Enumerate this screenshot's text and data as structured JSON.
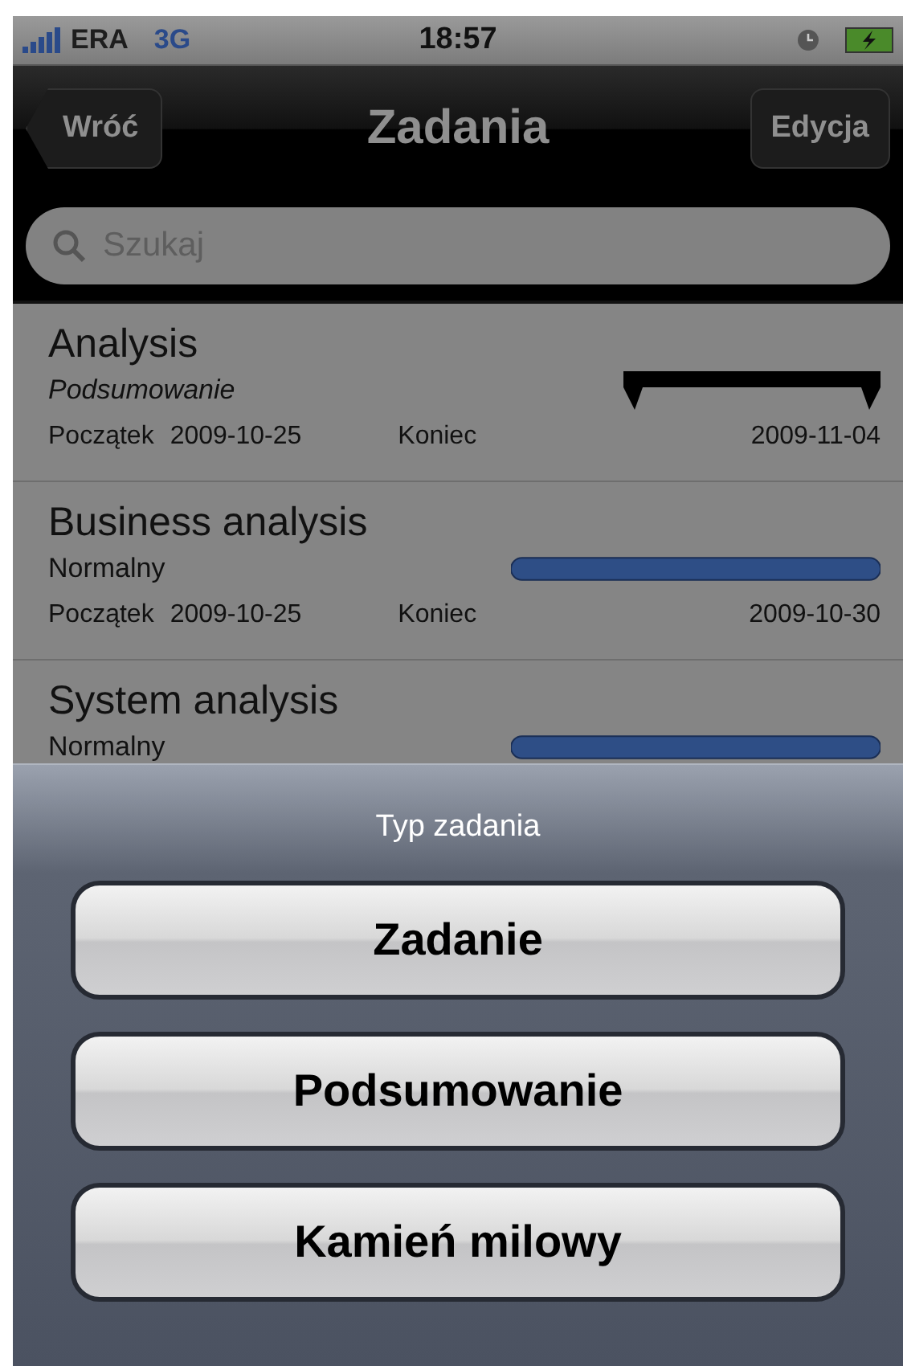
{
  "status_bar": {
    "carrier": "ERA",
    "network": "3G",
    "time": "18:57"
  },
  "nav_bar": {
    "back": "Wróć",
    "title": "Zadania",
    "edit": "Edycja"
  },
  "search": {
    "placeholder": "Szukaj"
  },
  "tasks": [
    {
      "name": "Analysis",
      "type": "Podsumowanie",
      "kind": "summary",
      "start_label": "Początek",
      "start": "2009-10-25",
      "end_label": "Koniec",
      "end": "2009-11-04"
    },
    {
      "name": "Business analysis",
      "type": "Normalny",
      "kind": "task",
      "start_label": "Początek",
      "start": "2009-10-25",
      "end_label": "Koniec",
      "end": "2009-10-30"
    },
    {
      "name": "System analysis",
      "type": "Normalny",
      "kind": "task"
    }
  ],
  "action_sheet": {
    "title": "Typ zadania",
    "buttons": [
      "Zadanie",
      "Podsumowanie",
      "Kamień milowy"
    ]
  }
}
